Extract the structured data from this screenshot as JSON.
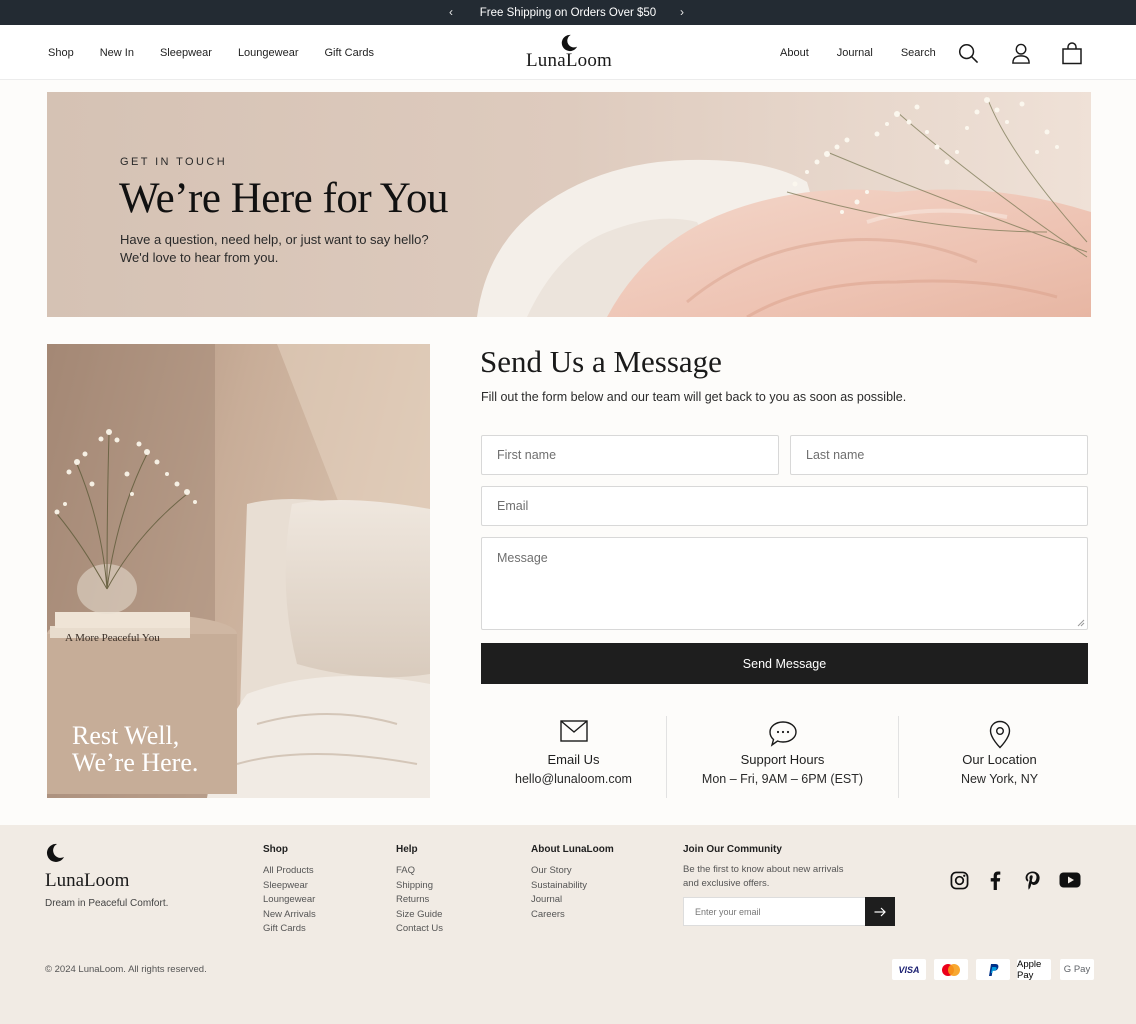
{
  "announcement": {
    "text": "Free Shipping on Orders Over $50",
    "prev_icon": "chevron-left-icon",
    "next_icon": "chevron-right-icon"
  },
  "header": {
    "logo": "LunaLoom",
    "nav_left": [
      "Shop",
      "New In",
      "Sleepwear",
      "Loungewear",
      "Gift Cards"
    ],
    "nav_right": [
      "About",
      "Journal",
      "Search"
    ],
    "icons": [
      "search-icon",
      "user-icon",
      "bag-icon"
    ]
  },
  "hero": {
    "eyebrow": "GET IN TOUCH",
    "title": "We’re Here for You",
    "subtitle_line1": "Have a question, need help, or just want to say hello?",
    "subtitle_line2": "We'd love to hear from you."
  },
  "side_image": {
    "book_title": "A More Peaceful You",
    "caption_line1": "Rest Well,",
    "caption_line2": "We’re Here."
  },
  "form": {
    "title": "Send Us a Message",
    "subtitle": "Fill out the form below and our team will get back to you as soon as possible.",
    "first_name_placeholder": "First name",
    "last_name_placeholder": "Last name",
    "email_placeholder": "Email",
    "message_placeholder": "Message",
    "submit_label": "Send Message"
  },
  "info": [
    {
      "icon": "mail-icon",
      "label": "Email Us",
      "value": "hello@lunaloom.com"
    },
    {
      "icon": "chat-icon",
      "label": "Support Hours",
      "value": "Mon – Fri, 9AM – 6PM (EST)"
    },
    {
      "icon": "location-pin-icon",
      "label": "Our Location",
      "value": "New York, NY"
    }
  ],
  "footer": {
    "logo": "LunaLoom",
    "tagline": "Dream in Peaceful Comfort.",
    "columns": [
      {
        "heading": "Shop",
        "links": [
          "All Products",
          "Sleepwear",
          "Loungewear",
          "New Arrivals",
          "Gift Cards"
        ]
      },
      {
        "heading": "Help",
        "links": [
          "FAQ",
          "Shipping",
          "Returns",
          "Size Guide",
          "Contact Us"
        ]
      },
      {
        "heading": "About LunaLoom",
        "links": [
          "Our Story",
          "Sustainability",
          "Journal",
          "Careers"
        ]
      }
    ],
    "community": {
      "heading": "Join Our Community",
      "text_line1": "Be the first to know about new arrivals",
      "text_line2": "and exclusive offers.",
      "email_placeholder": "Enter your email"
    },
    "social": [
      "instagram-icon",
      "facebook-icon",
      "pinterest-icon",
      "youtube-icon"
    ],
    "copyright": "© 2024 LunaLoom. All rights reserved.",
    "payments": [
      "VISA",
      "Mastercard",
      "PayPal",
      "Apple Pay",
      "G Pay"
    ]
  },
  "colors": {
    "announcement_bg": "#232b33",
    "button_bg": "#1e1e1e",
    "footer_bg": "#f1ebe4",
    "hero_blush": "#f0cdbf"
  }
}
